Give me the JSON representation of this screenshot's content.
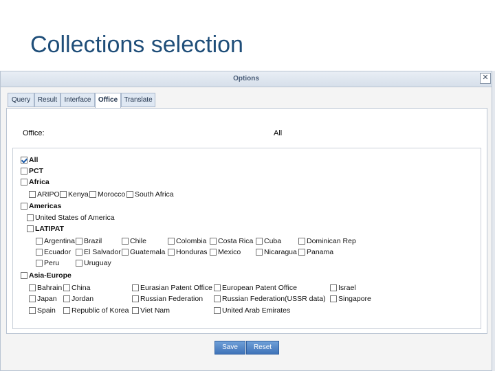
{
  "slide": {
    "title": "Collections selection"
  },
  "dialog": {
    "title": "Options",
    "close_glyph": "✕",
    "tabs": [
      {
        "label": "Query",
        "active": false
      },
      {
        "label": "Result",
        "active": false
      },
      {
        "label": "Interface",
        "active": false
      },
      {
        "label": "Office",
        "active": true
      },
      {
        "label": "Translate",
        "active": false
      }
    ],
    "office_label": "Office:",
    "office_value": "All",
    "tree": {
      "all": {
        "label": "All",
        "checked": true
      },
      "pct": {
        "label": "PCT",
        "checked": false
      },
      "africa": {
        "label": "Africa",
        "checked": false,
        "children": [
          "ARIPO",
          "Kenya",
          "Morocco",
          "South Africa"
        ]
      },
      "americas": {
        "label": "Americas",
        "checked": false,
        "usa": "United States of America",
        "latipat": "LATIPAT",
        "latipat_children": [
          "Argentina",
          "Brazil",
          "Chile",
          "Colombia",
          "Costa Rica",
          "Cuba",
          "Dominican Rep",
          "Ecuador",
          "El Salvador",
          "Guatemala",
          "Honduras",
          "Mexico",
          "Nicaragua",
          "Panama",
          "Peru",
          "Uruguay"
        ]
      },
      "asia_europe": {
        "label": "Asia-Europe",
        "checked": false,
        "children": [
          "Bahrain",
          "China",
          "Eurasian Patent Office",
          "European Patent Office",
          "Israel",
          "Japan",
          "Jordan",
          "Russian Federation",
          "Russian Federation(USSR data)",
          "Singapore",
          "Spain",
          "Republic of Korea",
          "Viet Nam",
          "United Arab Emirates"
        ]
      }
    },
    "buttons": {
      "save": "Save",
      "reset": "Reset"
    },
    "colors": {
      "accent": "#3f73b8",
      "title": "#1f4e79"
    }
  }
}
